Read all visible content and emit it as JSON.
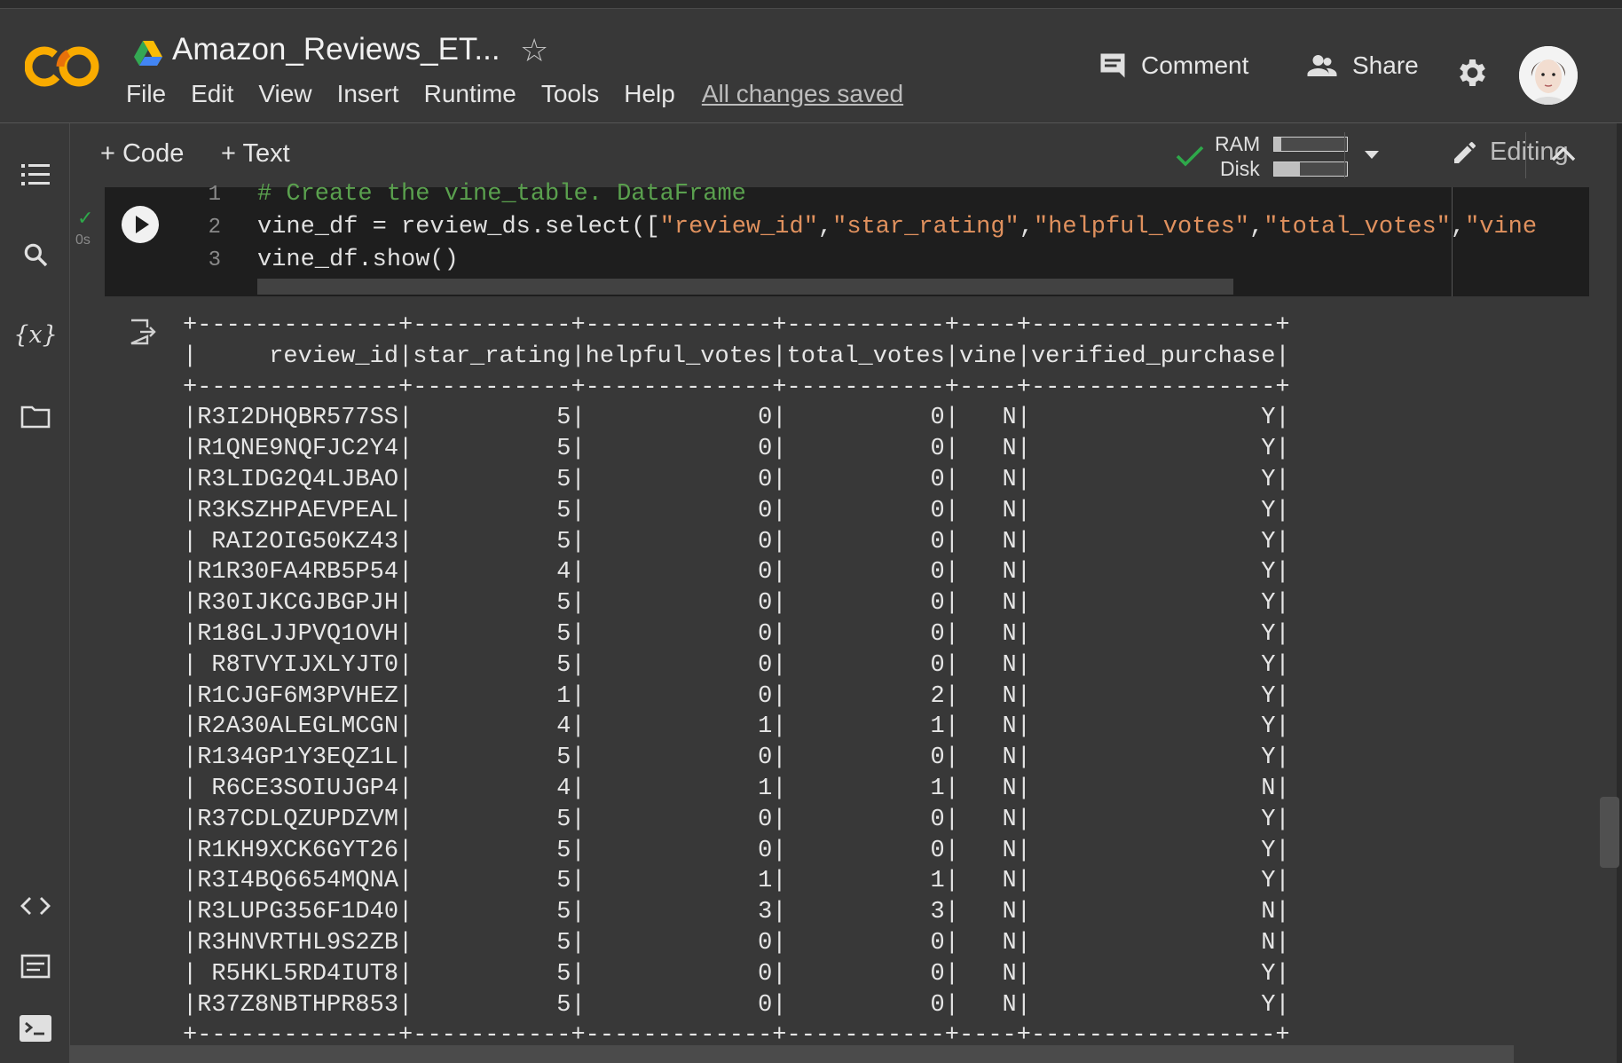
{
  "header": {
    "notebook_title": "Amazon_Reviews_ET...",
    "menu": [
      "File",
      "Edit",
      "View",
      "Insert",
      "Runtime",
      "Tools",
      "Help"
    ],
    "save_status": "All changes saved",
    "comment_label": "Comment",
    "share_label": "Share"
  },
  "toolbar": {
    "add_code_label": "+ Code",
    "add_text_label": "+ Text",
    "ram_label": "RAM",
    "disk_label": "Disk",
    "ram_usage": 0.1,
    "disk_usage": 0.35,
    "editing_label": "Editing"
  },
  "cell": {
    "exec_time": "0s",
    "line_numbers": [
      "1",
      "2",
      "3"
    ],
    "code_lines": [
      "# Create the vine_table. DataFrame",
      "vine_df = review_ds.select([\"review_id\",\"star_rating\",\"helpful_votes\",\"total_votes\",\"vine",
      "vine_df.show()"
    ]
  },
  "output": {
    "columns": [
      "review_id",
      "star_rating",
      "helpful_votes",
      "total_votes",
      "vine",
      "verified_purchase"
    ],
    "rows": [
      [
        "R3I2DHQBR577SS",
        "5",
        "0",
        "0",
        "N",
        "Y"
      ],
      [
        "R1QNE9NQFJC2Y4",
        "5",
        "0",
        "0",
        "N",
        "Y"
      ],
      [
        "R3LIDG2Q4LJBAO",
        "5",
        "0",
        "0",
        "N",
        "Y"
      ],
      [
        "R3KSZHPAEVPEAL",
        "5",
        "0",
        "0",
        "N",
        "Y"
      ],
      [
        "RAI2OIG50KZ43",
        "5",
        "0",
        "0",
        "N",
        "Y"
      ],
      [
        "R1R30FA4RB5P54",
        "4",
        "0",
        "0",
        "N",
        "Y"
      ],
      [
        "R30IJKCGJBGPJH",
        "5",
        "0",
        "0",
        "N",
        "Y"
      ],
      [
        "R18GLJJPVQ1OVH",
        "5",
        "0",
        "0",
        "N",
        "Y"
      ],
      [
        "R8TVYIJXLYJT0",
        "5",
        "0",
        "0",
        "N",
        "Y"
      ],
      [
        "R1CJGF6M3PVHEZ",
        "1",
        "0",
        "2",
        "N",
        "Y"
      ],
      [
        "R2A30ALEGLMCGN",
        "4",
        "1",
        "1",
        "N",
        "Y"
      ],
      [
        "R134GP1Y3EQZ1L",
        "5",
        "0",
        "0",
        "N",
        "Y"
      ],
      [
        "R6CE3SOIUJGP4",
        "4",
        "1",
        "1",
        "N",
        "N"
      ],
      [
        "R37CDLQZUPDZVM",
        "5",
        "0",
        "0",
        "N",
        "Y"
      ],
      [
        "R1KH9XCK6GYT26",
        "5",
        "0",
        "0",
        "N",
        "Y"
      ],
      [
        "R3I4BQ6654MQNA",
        "5",
        "1",
        "1",
        "N",
        "Y"
      ],
      [
        "R3LUPG356F1D40",
        "5",
        "3",
        "3",
        "N",
        "N"
      ],
      [
        "R3HNVRTHL9S2ZB",
        "5",
        "0",
        "0",
        "N",
        "N"
      ],
      [
        "R5HKL5RD4IUT8",
        "5",
        "0",
        "0",
        "N",
        "Y"
      ],
      [
        "R37Z8NBTHPR853",
        "5",
        "0",
        "0",
        "N",
        "Y"
      ]
    ]
  }
}
